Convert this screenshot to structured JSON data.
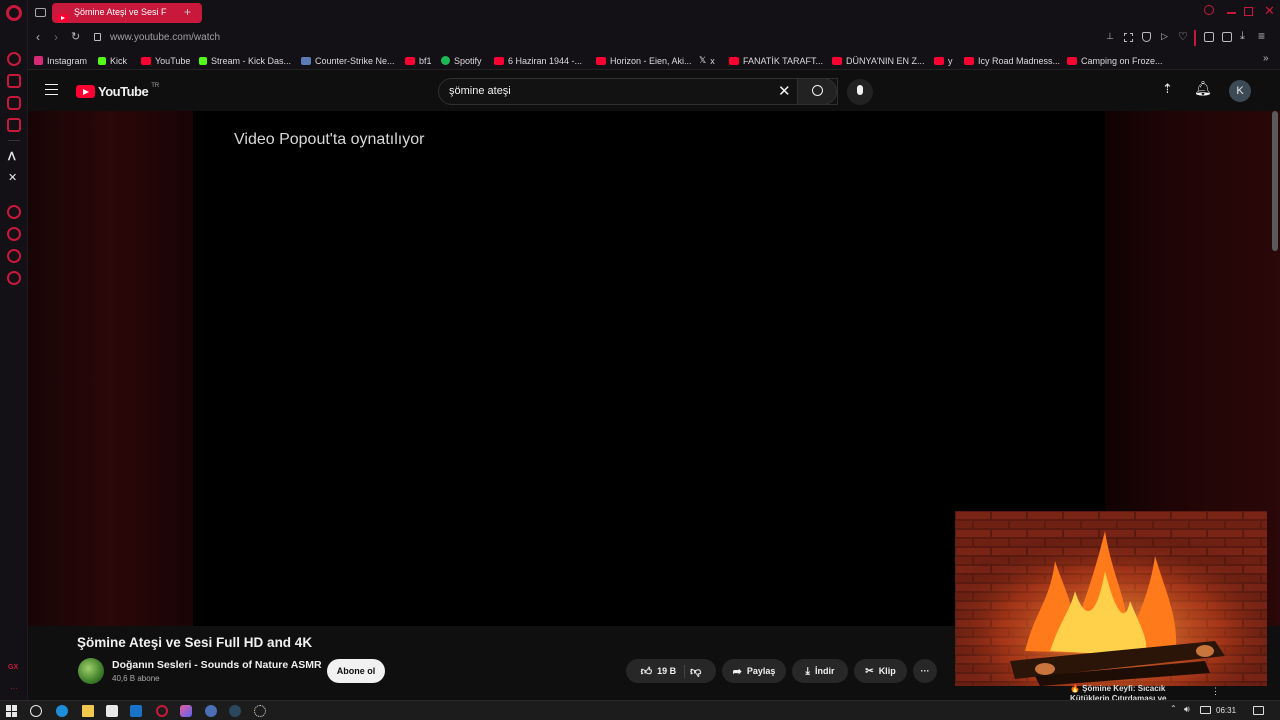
{
  "browser": {
    "active_tab_title": "Şömine Ateşi ve Sesi F",
    "url": "www.youtube.com/watch"
  },
  "bookmarks": [
    {
      "label": "Instagram",
      "icon": "instagram-icon",
      "color": "#d62976"
    },
    {
      "label": "Kick",
      "icon": "kick-icon",
      "color": "#53fc18"
    },
    {
      "label": "YouTube",
      "icon": "youtube-icon",
      "color": "#ff0033"
    },
    {
      "label": "Stream - Kick Das...",
      "icon": "kick-icon",
      "color": "#53fc18"
    },
    {
      "label": "Counter-Strike Ne...",
      "icon": "cs-icon",
      "color": "#5a7bb5"
    },
    {
      "label": "bf1",
      "icon": "youtube-icon",
      "color": "#ff0033"
    },
    {
      "label": "Spotify",
      "icon": "spotify-icon",
      "color": "#1db954"
    },
    {
      "label": "6 Haziran 1944 -...",
      "icon": "youtube-icon",
      "color": "#ff0033"
    },
    {
      "label": "Horizon - Eien, Aki...",
      "icon": "youtube-icon",
      "color": "#ff0033"
    },
    {
      "label": "x",
      "icon": "x-icon",
      "color": "#e8e8e8"
    },
    {
      "label": "FANATİK TARAFT...",
      "icon": "youtube-icon",
      "color": "#ff0033"
    },
    {
      "label": "DÜNYA'NIN EN Z...",
      "icon": "youtube-icon",
      "color": "#ff0033"
    },
    {
      "label": "y",
      "icon": "youtube-icon",
      "color": "#ff0033"
    },
    {
      "label": "Icy Road Madness...",
      "icon": "youtube-icon",
      "color": "#ff0033"
    },
    {
      "label": "Camping on Froze...",
      "icon": "youtube-icon",
      "color": "#ff0033"
    }
  ],
  "youtube": {
    "logo": "YouTube",
    "region": "TR",
    "search_value": "şömine ateşi",
    "avatar_letter": "K"
  },
  "player": {
    "popout_message": "Video Popout'ta oynatılıyor"
  },
  "video": {
    "title": "Şömine Ateşi ve Sesi Full HD and 4K",
    "channel_name": "Doğanın Sesleri - Sounds of Nature ASMR",
    "subscribers": "40,6 B abone",
    "subscribe_label": "Abone ol",
    "likes": "19 B",
    "share_label": "Paylaş",
    "download_label": "İndir",
    "clip_label": "Klip"
  },
  "miniplayer": {
    "next_title_line1": "🔥 Şömine Keyfi: Sıcacık",
    "next_title_line2": "Kütüklerin Çıtırdaması ve"
  },
  "taskbar": {
    "time": "06:31"
  },
  "colors": {
    "opera_red": "#c8193c",
    "youtube_red": "#ff0033",
    "background": "#0f0f0f"
  }
}
